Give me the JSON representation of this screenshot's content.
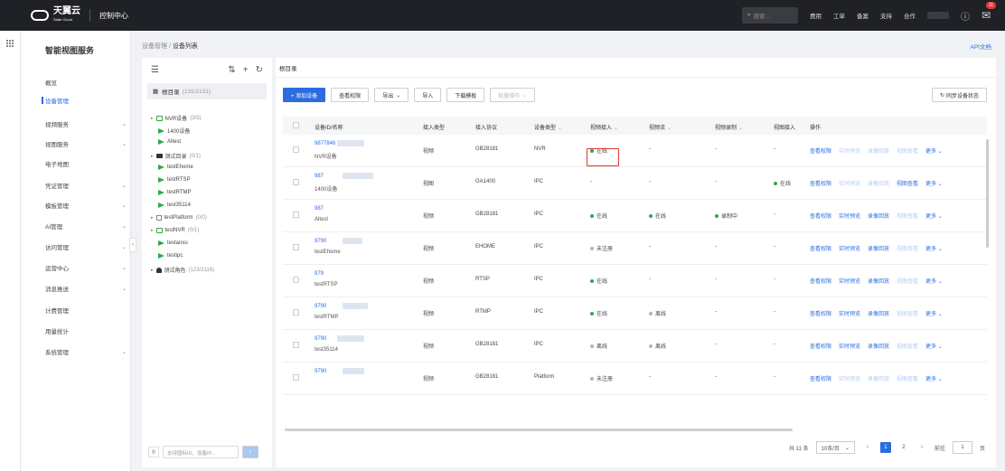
{
  "topbar": {
    "brand": "天翼云",
    "brand_sub": "State Cloud",
    "console": "控制中心",
    "search_placeholder": "搜索...",
    "links": [
      "费用",
      "工单",
      "备案",
      "支持",
      "合作"
    ],
    "notification_count": "11"
  },
  "sidebar": {
    "title": "智能视图服务",
    "items": [
      {
        "label": "概览",
        "chevron": false,
        "active": false
      },
      {
        "label": "设备管理",
        "chevron": false,
        "active": true
      },
      {
        "label": "视频服务",
        "chevron": true,
        "active": false
      },
      {
        "label": "视图服务",
        "chevron": true,
        "active": false
      },
      {
        "label": "电子地图",
        "chevron": false,
        "active": false
      },
      {
        "label": "凭证管理",
        "chevron": true,
        "active": false
      },
      {
        "label": "模板管理",
        "chevron": true,
        "active": false
      },
      {
        "label": "AI管理",
        "chevron": true,
        "active": false
      },
      {
        "label": "访问管理",
        "chevron": true,
        "active": false
      },
      {
        "label": "运营中心",
        "chevron": true,
        "active": false
      },
      {
        "label": "消息推送",
        "chevron": true,
        "active": false
      },
      {
        "label": "计费管理",
        "chevron": false,
        "active": false
      },
      {
        "label": "用量统计",
        "chevron": false,
        "active": false
      },
      {
        "label": "系统管理",
        "chevron": true,
        "active": false
      }
    ]
  },
  "breadcrumb": {
    "parent": "设备管理",
    "sep": " / ",
    "current": "设备列表"
  },
  "api_doc": "API文档",
  "tree": {
    "root_label": "根目录",
    "root_count": "(131/2131)",
    "nodes": [
      {
        "label": "NVR设备",
        "count": "(3/5)",
        "icon": "nvr"
      },
      {
        "label": "1400设备",
        "count": "",
        "icon": "camera"
      },
      {
        "label": "Altest",
        "count": "",
        "icon": "camera"
      },
      {
        "label": "测试目录",
        "count": "(0/1)",
        "icon": "folder"
      },
      {
        "label": "testEhome",
        "count": "",
        "icon": "camera"
      },
      {
        "label": "testRTSP",
        "count": "",
        "icon": "camera"
      },
      {
        "label": "testRTMP",
        "count": "",
        "icon": "camera"
      },
      {
        "label": "test35114",
        "count": "",
        "icon": "camera"
      },
      {
        "label": "testPlatform",
        "count": "(0/0)",
        "icon": "platform"
      },
      {
        "label": "testNVR",
        "count": "(0/1)",
        "icon": "nvr"
      },
      {
        "label": "testanxu",
        "count": "",
        "icon": "camera"
      },
      {
        "label": "testipc",
        "count": "",
        "icon": "camera"
      },
      {
        "label": "测试角色",
        "count": "(123/2116)",
        "icon": "role"
      }
    ],
    "search_placeholder": "支持国标ID、设备IP..."
  },
  "main": {
    "title": "根目录",
    "toolbar": {
      "add": "+ 添加设备",
      "perm": "查看权限",
      "export": "导出",
      "import": "导入",
      "download": "下载模板",
      "batch": "批量操作",
      "sync": "同步设备状态"
    },
    "columns": [
      "设备ID/名称",
      "接入类型",
      "接入协议",
      "设备类型",
      "视频接入",
      "视频流",
      "视频录制",
      "视图接入",
      "操作"
    ],
    "ops": {
      "view_perm": "查看权限",
      "live": "实时预览",
      "playback": "录像回放",
      "image": "视图查看",
      "more": "更多"
    },
    "rows": [
      {
        "id": "9877846",
        "name": "NVR设备",
        "access": "视频",
        "protocol": "GB28181",
        "type": "NVR",
        "video": "在线",
        "stream": "-",
        "record": "-",
        "view": "-"
      },
      {
        "id": "987",
        "name": "1400设备",
        "access": "视图",
        "protocol": "GA1400",
        "type": "IPC",
        "video": "-",
        "stream": "-",
        "record": "-",
        "view": "在线"
      },
      {
        "id": "987",
        "name": "Altest",
        "access": "视频",
        "protocol": "GB28181",
        "type": "IPC",
        "video": "在线",
        "stream": "在线",
        "record": "录制中",
        "view": "-"
      },
      {
        "id": "9790",
        "name": "testEhome",
        "access": "视频",
        "protocol": "EHOME",
        "type": "IPC",
        "video": "未注册",
        "stream": "-",
        "record": "-",
        "view": "-"
      },
      {
        "id": "979",
        "name": "testRTSP",
        "access": "视频",
        "protocol": "RTSP",
        "type": "IPC",
        "video": "在线",
        "stream": "-",
        "record": "-",
        "view": "-"
      },
      {
        "id": "9790",
        "name": "testRTMP",
        "access": "视频",
        "protocol": "RTMP",
        "type": "IPC",
        "video": "在线",
        "stream": "离线",
        "record": "-",
        "view": "-"
      },
      {
        "id": "9790",
        "name": "test35114",
        "access": "视频",
        "protocol": "GB28181",
        "type": "IPC",
        "video": "离线",
        "stream": "离线",
        "record": "-",
        "view": "-"
      },
      {
        "id": "9790",
        "name": "",
        "access": "视频",
        "protocol": "GB28181",
        "type": "Platform",
        "video": "未注册",
        "stream": "-",
        "record": "-",
        "view": "-"
      }
    ],
    "pager": {
      "total": "共 11 条",
      "page_size": "10条/页",
      "pages": [
        "1",
        "2"
      ],
      "goto": "前往",
      "goto_value": "1",
      "page_unit": "页"
    }
  },
  "colors": {
    "accent": "#2b6de0",
    "online": "#2ea84b",
    "highlight": "#e2372b"
  }
}
